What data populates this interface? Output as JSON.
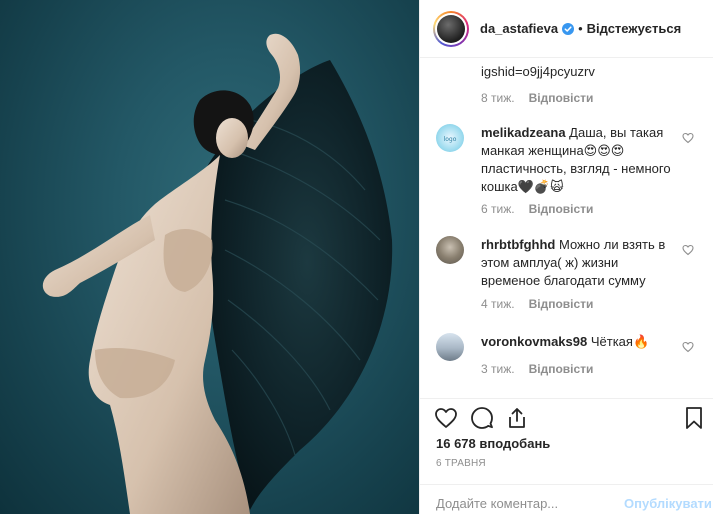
{
  "header": {
    "username": "da_astafieva",
    "separator": "•",
    "follow_label": "Відстежується"
  },
  "caption": {
    "tail_text": "igshid=o9jj4pcyuzrv",
    "time": "8 тиж.",
    "reply_label": "Відповісти"
  },
  "comments": [
    {
      "username": "melikadzeana",
      "text": "Даша, вы такая манкая женщина😍😍😍 пластичность, взгляд - немного кошка🖤💣🙀",
      "time": "6 тиж.",
      "reply_label": "Відповісти"
    },
    {
      "username": "rhrbtbfghhd",
      "text": "Можно ли взять в этом амплуа( ж) жизни временое благодати сумму",
      "time": "4 тиж.",
      "reply_label": "Відповісти"
    },
    {
      "username": "voronkovmaks98",
      "text": "Чёткая🔥",
      "time": "3 тиж.",
      "reply_label": "Відповісти"
    }
  ],
  "post": {
    "likes": "16 678 вподобань",
    "date": "6 ТРАВНЯ"
  },
  "composer": {
    "placeholder": "Додайте коментар...",
    "publish_label": "Опублікувати"
  },
  "icons": {
    "like": "heart-icon",
    "comment": "comment-icon",
    "share": "share-icon",
    "save": "bookmark-icon",
    "verified": "verified-badge-icon"
  },
  "colors": {
    "verified": "#3897f0",
    "publish_disabled": "#b3dbff",
    "muted": "#8e8e8e",
    "backdrop": "#235866"
  }
}
